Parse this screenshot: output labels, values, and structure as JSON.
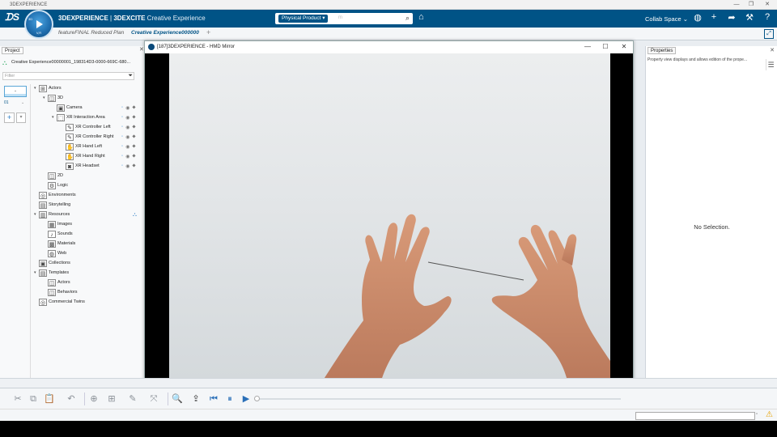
{
  "window": {
    "title": "3DEXPERIENCE",
    "controls": [
      "—",
      "❐",
      "✕"
    ]
  },
  "topbar": {
    "brand_main": "3DEXPERIENCE",
    "brand_sep": " | ",
    "brand_sub": "3DEXCITE",
    "app_name": " Creative Experience",
    "compass_top": "3D",
    "compass_bottom": "V,R",
    "search": {
      "tag": "Physical Product ▾",
      "ghost": "m"
    },
    "collab_space": "Collab Space ⌄",
    "icons": [
      "user-icon",
      "add-icon",
      "share-icon",
      "tools-icon",
      "help-icon"
    ],
    "icon_glyphs": [
      "◍",
      "+",
      "➦",
      "⚒",
      "?"
    ]
  },
  "tabs": [
    {
      "label": "featureFINAL Reduced Plan",
      "active": false
    },
    {
      "label": "Creative Experience000000",
      "active": true
    }
  ],
  "tab_plus": "+",
  "left_panel": {
    "tab_label": "Project",
    "project_name": "Creative Experience00000001_198314D3-0000-669C-680...",
    "filter_placeholder": "Filter",
    "version_button": "-",
    "version_label": "01",
    "tree": [
      {
        "label": "Actors",
        "depth": 0,
        "twist": "▾",
        "icon": "⊞"
      },
      {
        "label": "3D",
        "depth": 1,
        "twist": "▾",
        "icon": "◫"
      },
      {
        "label": "Camera",
        "depth": 2,
        "twist": "",
        "icon": "▣",
        "flags": true
      },
      {
        "label": "XR Interaction Area",
        "depth": 2,
        "twist": "▾",
        "icon": "⬚",
        "flags": true
      },
      {
        "label": "XR Controller Left",
        "depth": 3,
        "twist": "",
        "icon": "✎",
        "flags": true
      },
      {
        "label": "XR Controller Right",
        "depth": 3,
        "twist": "",
        "icon": "✎",
        "flags": true
      },
      {
        "label": "XR Hand Left",
        "depth": 3,
        "twist": "",
        "icon": "✋",
        "flags": true
      },
      {
        "label": "XR Hand Right",
        "depth": 3,
        "twist": "",
        "icon": "✋",
        "flags": true
      },
      {
        "label": "XR Headset",
        "depth": 3,
        "twist": "",
        "icon": "◙",
        "flags": true
      },
      {
        "label": "2D",
        "depth": 1,
        "twist": "",
        "icon": "◫"
      },
      {
        "label": "Logic",
        "depth": 1,
        "twist": "",
        "icon": "⚙"
      },
      {
        "label": "Environments",
        "depth": 0,
        "twist": "",
        "icon": "◎"
      },
      {
        "label": "Storytelling",
        "depth": 0,
        "twist": "",
        "icon": "▤"
      },
      {
        "label": "Resources",
        "depth": 0,
        "twist": "▾",
        "icon": "▥"
      },
      {
        "label": "Images",
        "depth": 1,
        "twist": "",
        "icon": "▦"
      },
      {
        "label": "Sounds",
        "depth": 1,
        "twist": "",
        "icon": "♪"
      },
      {
        "label": "Materials",
        "depth": 1,
        "twist": "",
        "icon": "▩"
      },
      {
        "label": "Web",
        "depth": 1,
        "twist": "",
        "icon": "◍"
      },
      {
        "label": "Collections",
        "depth": 0,
        "twist": "",
        "icon": "▣"
      },
      {
        "label": "Templates",
        "depth": 0,
        "twist": "▾",
        "icon": "▤"
      },
      {
        "label": "Actors",
        "depth": 1,
        "twist": "",
        "icon": "◫"
      },
      {
        "label": "Behaviors",
        "depth": 1,
        "twist": "",
        "icon": "◫"
      },
      {
        "label": "Commercial Twins",
        "depth": 0,
        "twist": "",
        "icon": "◎"
      }
    ],
    "flag_glyphs": [
      "◦",
      "◉",
      "⬥"
    ]
  },
  "hmd_window": {
    "title": "[187]3DEXPERIENCE - HMD Mirror",
    "controls": [
      "—",
      "☐",
      "✕"
    ]
  },
  "right_panel": {
    "tab_label": "Properties",
    "description": "Property view displays and allows edition of the prope...",
    "menu": "☰",
    "empty_text": "No Selection."
  },
  "toolbar": {
    "icons": [
      "cut-icon",
      "copy-icon",
      "paste-icon",
      "undo-icon",
      "zoom-fit-icon",
      "group-icon",
      "pen-icon",
      "transform-icon",
      "search-icon",
      "export-icon",
      "step-back-icon",
      "pause-icon",
      "play-icon"
    ],
    "glyphs": [
      "✂",
      "⧉",
      "📋",
      "↶",
      "⊕",
      "⊞",
      "✎",
      "⤧",
      "🔍",
      "⇪",
      "⏮",
      "⏸",
      "▶"
    ]
  },
  "status": {
    "warning_icon": "⚠",
    "button": "▫"
  }
}
